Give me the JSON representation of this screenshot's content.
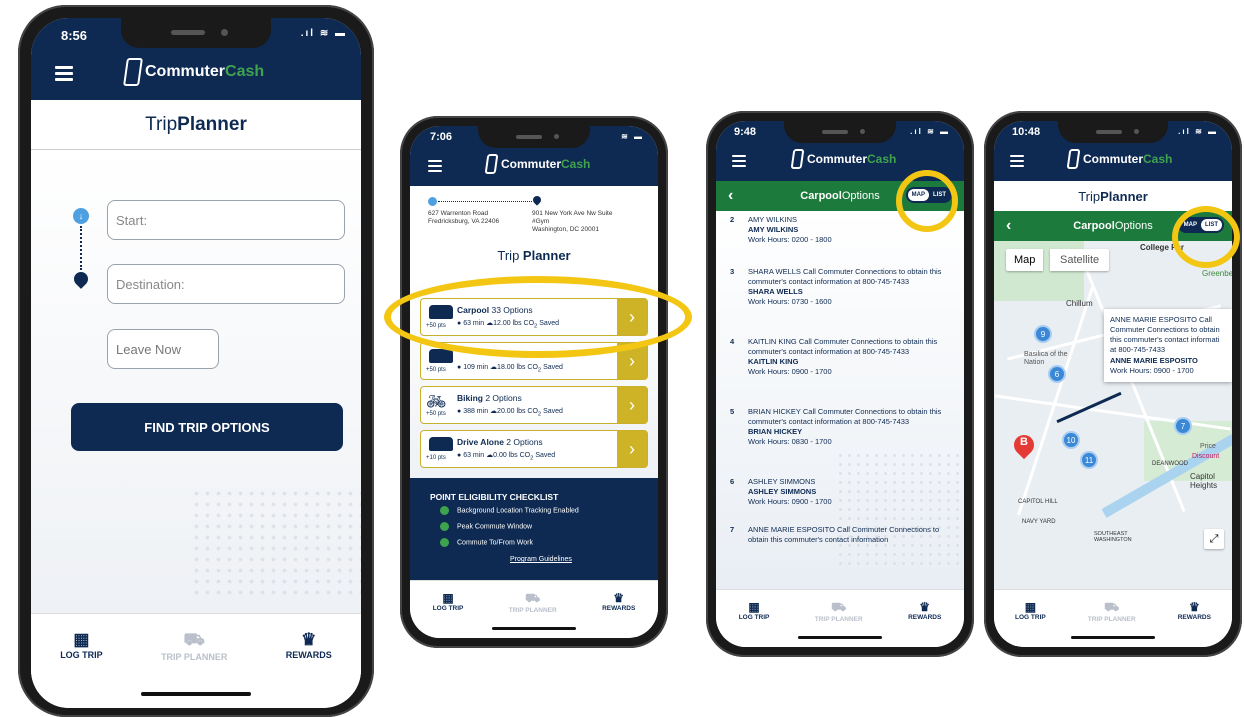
{
  "brand": {
    "name_part1": "Commuter",
    "name_part2": "Cash",
    "navy": "#0e2a52",
    "green": "#3fa34d",
    "accent_yellow": "#f4c614"
  },
  "phone1": {
    "time": "8:56",
    "title_light": "Trip ",
    "title_bold": "Planner",
    "start_placeholder": "Start:",
    "destination_placeholder": "Destination:",
    "leave_now": "Leave Now",
    "find_button": "FIND TRIP OPTIONS"
  },
  "phone2": {
    "time": "7:06",
    "origin_line1": "627 Warrenton Road",
    "origin_line2": "Fredricksburg, VA 22406",
    "dest_line1": "901 New York Ave Nw Suite",
    "dest_line2": "#Gym",
    "dest_line3": "Washington, DC 20001",
    "title_light": "Trip ",
    "title_bold": "Planner",
    "options": [
      {
        "mode": "Carpool",
        "count": " 33 Options",
        "time": "63 min",
        "saved": "12.00 lbs CO",
        "saved_suffix": " Saved",
        "pts": "+50 pts"
      },
      {
        "mode": "",
        "count": "",
        "time": "109 min",
        "saved": "18.00 lbs CO",
        "saved_suffix": " Saved",
        "pts": "+50 pts"
      },
      {
        "mode": "Biking",
        "count": " 2 Options",
        "time": "388 min",
        "saved": "20.00 lbs CO",
        "saved_suffix": " Saved",
        "pts": "+50 pts"
      },
      {
        "mode": "Drive Alone",
        "count": " 2 Options",
        "time": "63 min",
        "saved": "0.00 lbs CO",
        "saved_suffix": " Saved",
        "pts": "+10 pts"
      }
    ],
    "checklist_title": "POINT ELIGIBILITY CHECKLIST",
    "checklist": [
      "Background Location Tracking Enabled",
      "Peak Commute Window",
      "Commute To/From Work"
    ],
    "guidelines_link": "Program Guidelines"
  },
  "phone3": {
    "time": "9:48",
    "header_bold": "Carpool",
    "header_light": " Options",
    "toggle_map": "MAP",
    "toggle_list": "LIST",
    "items": [
      {
        "n": "2",
        "line1": "AMY WILKINS",
        "name": "AMY WILKINS",
        "hours": "Work Hours: 0200 - 1800"
      },
      {
        "n": "3",
        "line1": "SHARA WELLS Call Commuter Connections to obtain this commuter's contact information at 800-745-7433",
        "name": "SHARA WELLS",
        "hours": "Work Hours: 0730 - 1600"
      },
      {
        "n": "4",
        "line1": "KAITLIN KING Call Commuter Connections to obtain this commuter's contact information at 800-745-7433",
        "name": "KAITLIN KING",
        "hours": "Work Hours: 0900 - 1700"
      },
      {
        "n": "5",
        "line1": "BRIAN HICKEY Call Commuter Connections to obtain this commuter's contact information at 800-745-7433",
        "name": "BRIAN HICKEY",
        "hours": "Work Hours: 0830 - 1700"
      },
      {
        "n": "6",
        "line1": "ASHLEY SIMMONS",
        "name": "ASHLEY SIMMONS",
        "hours": "Work Hours: 0900 - 1700"
      },
      {
        "n": "7",
        "line1": "ANNE MARIE ESPOSITO Call Commuter Connections to obtain this commuter's contact information",
        "name": "",
        "hours": ""
      }
    ]
  },
  "phone4": {
    "time": "10:48",
    "title_light": "Trip ",
    "title_bold": "Planner",
    "header_bold": "Carpool",
    "header_light": " Options",
    "toggle_map": "MAP",
    "toggle_list": "LIST",
    "map_btn": "Map",
    "satellite_btn": "Satellite",
    "info_line": "ANNE MARIE ESPOSITO Call Commuter Connections to obtain this commuter's contact informati at 800-745-7433",
    "info_name": "ANNE MARIE ESPOSITO",
    "info_hours": "Work Hours: 0900 - 1700",
    "marker": "B",
    "clusters": [
      "9",
      "6",
      "10",
      "11",
      "7"
    ],
    "places": [
      "College Par",
      "Chillum",
      "Basilica of the Nation",
      "CAPITOL HILL",
      "NAVY YARD",
      "SOUTHEAST WASHINGTON",
      "DEANWOOD",
      "Capitol Heights",
      "Greenbe",
      "Discount",
      "Price"
    ]
  },
  "tabs": {
    "log_trip": "LOG TRIP",
    "trip_planner": "TRIP PLANNER",
    "rewards": "REWARDS"
  }
}
